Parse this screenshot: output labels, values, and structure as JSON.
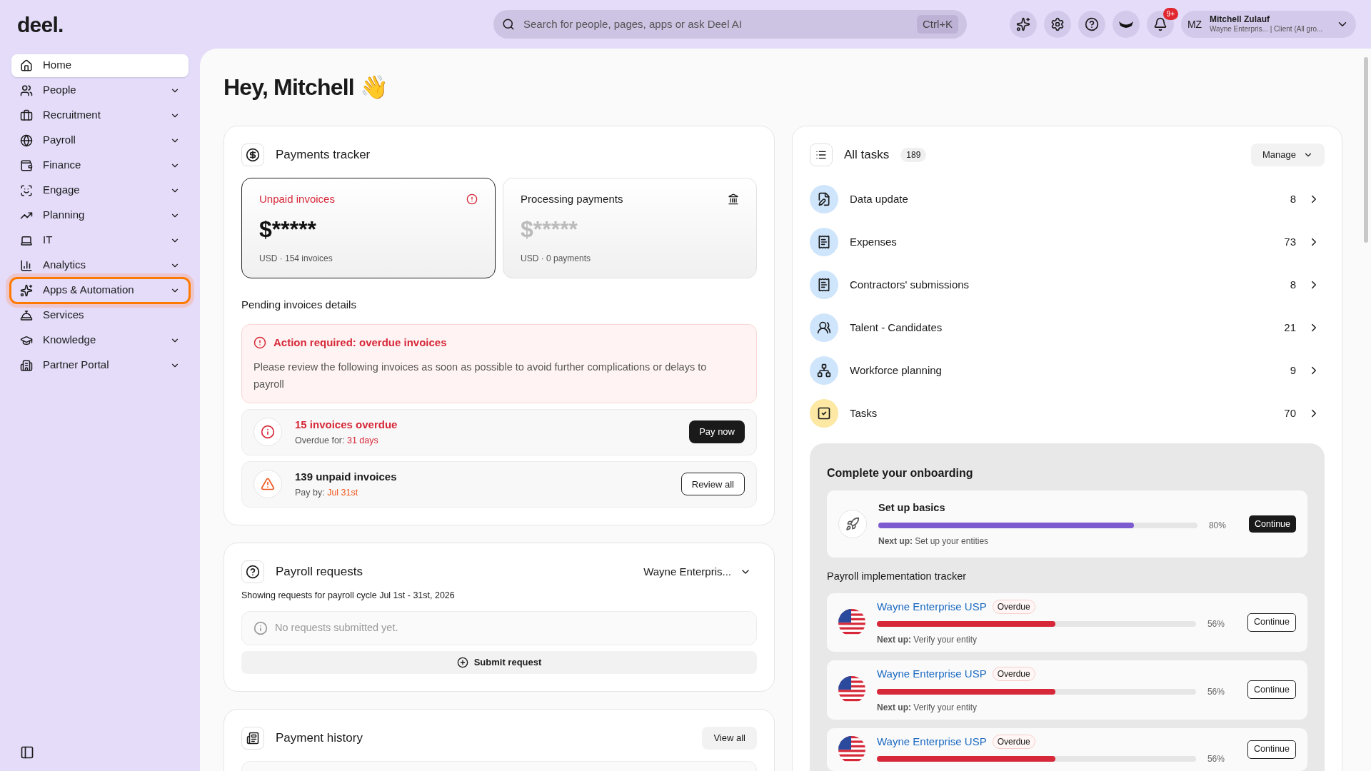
{
  "header": {
    "logo": "deel.",
    "search": {
      "placeholder": "Search for people, pages, apps or ask Deel AI",
      "shortcut": "Ctrl+K"
    },
    "notification_badge": "9+",
    "user": {
      "initials": "MZ",
      "name": "Mitchell Zulauf",
      "subtitle": "Wayne Enterpris... | Client (All gro..."
    }
  },
  "sidebar": {
    "items": [
      {
        "label": "Home",
        "expandable": false,
        "selected": true,
        "highlighted": false
      },
      {
        "label": "People",
        "expandable": true,
        "selected": false,
        "highlighted": false
      },
      {
        "label": "Recruitment",
        "expandable": true,
        "selected": false,
        "highlighted": false
      },
      {
        "label": "Payroll",
        "expandable": true,
        "selected": false,
        "highlighted": false
      },
      {
        "label": "Finance",
        "expandable": true,
        "selected": false,
        "highlighted": false
      },
      {
        "label": "Engage",
        "expandable": true,
        "selected": false,
        "highlighted": false
      },
      {
        "label": "Planning",
        "expandable": true,
        "selected": false,
        "highlighted": false
      },
      {
        "label": "IT",
        "expandable": true,
        "selected": false,
        "highlighted": false
      },
      {
        "label": "Analytics",
        "expandable": true,
        "selected": false,
        "highlighted": false
      },
      {
        "label": "Apps & Automation",
        "expandable": true,
        "selected": false,
        "highlighted": true
      },
      {
        "label": "Services",
        "expandable": false,
        "selected": false,
        "highlighted": false
      },
      {
        "label": "Knowledge",
        "expandable": true,
        "selected": false,
        "highlighted": false
      },
      {
        "label": "Partner Portal",
        "expandable": true,
        "selected": false,
        "highlighted": false
      }
    ]
  },
  "greeting": "Hey, Mitchell 👋",
  "payments_tracker": {
    "title": "Payments tracker",
    "cards": [
      {
        "label": "Unpaid invoices",
        "amount": "$*****",
        "meta": "USD · 154 invoices",
        "selected": true
      },
      {
        "label": "Processing payments",
        "amount": "$*****",
        "meta": "USD · 0 payments",
        "selected": false
      }
    ],
    "pending_title": "Pending invoices details",
    "alert": {
      "title": "Action required: overdue invoices",
      "body": "Please review the following invoices as soon as possible to avoid further complications or delays to payroll"
    },
    "rows": [
      {
        "kind": "overdue",
        "title": "15 invoices overdue",
        "detail_label": "Overdue for:",
        "detail_value": "31 days",
        "button": "Pay now"
      },
      {
        "kind": "unpaid",
        "title": "139 unpaid invoices",
        "detail_label": "Pay by:",
        "detail_value": "Jul 31st",
        "button": "Review all"
      }
    ]
  },
  "payroll_requests": {
    "title": "Payroll requests",
    "entity": "Wayne Enterpris...",
    "subtitle": "Showing requests for payroll cycle Jul 1st - 31st, 2026",
    "empty": "No requests submitted yet.",
    "button": "Submit request"
  },
  "payment_history": {
    "title": "Payment history",
    "button": "View all"
  },
  "tasks": {
    "title": "All tasks",
    "count": "189",
    "manage": "Manage",
    "items": [
      {
        "label": "Data update",
        "count": "8",
        "color": "#cfe5fc"
      },
      {
        "label": "Expenses",
        "count": "73",
        "color": "#cfe5fc"
      },
      {
        "label": "Contractors' submissions",
        "count": "8",
        "color": "#cfe5fc"
      },
      {
        "label": "Talent - Candidates",
        "count": "21",
        "color": "#cfe5fc"
      },
      {
        "label": "Workforce planning",
        "count": "9",
        "color": "#cfe5fc"
      },
      {
        "label": "Tasks",
        "count": "70",
        "color": "#fde8a4"
      }
    ]
  },
  "onboarding": {
    "title": "Complete your onboarding",
    "basics": {
      "title": "Set up basics",
      "level": 0.8,
      "percent": "80%",
      "next_label": "Next up:",
      "next_value": "Set up your entities",
      "button": "Continue"
    },
    "tracker_title": "Payroll implementation tracker",
    "entries": [
      {
        "name": "Wayne Enterprise USP",
        "badge": "Overdue",
        "level": 0.56,
        "percent": "56%",
        "next_label": "Next up:",
        "next_value": "Verify your entity",
        "button": "Continue"
      },
      {
        "name": "Wayne Enterprise USP",
        "badge": "Overdue",
        "level": 0.56,
        "percent": "56%",
        "next_label": "Next up:",
        "next_value": "Verify your entity",
        "button": "Continue"
      },
      {
        "name": "Wayne Enterprise USP",
        "badge": "Overdue",
        "level": 0.56,
        "percent": "56%",
        "button": "Continue"
      }
    ]
  }
}
